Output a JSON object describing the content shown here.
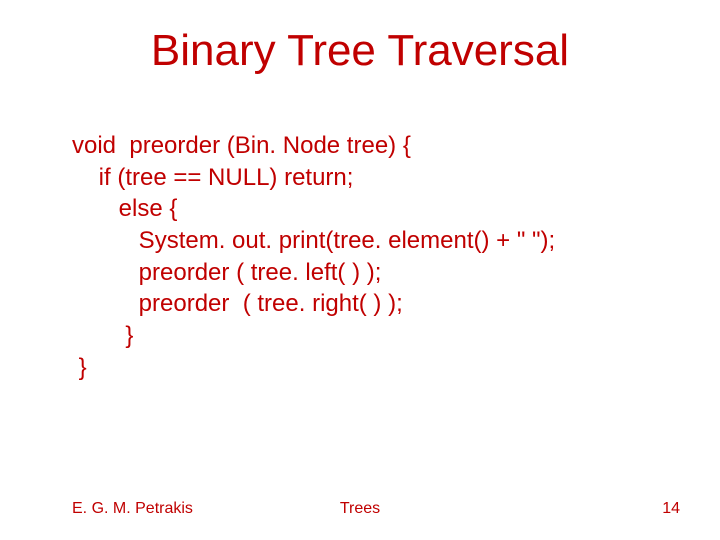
{
  "title": "Binary Tree Traversal",
  "code": {
    "lines": [
      "void  preorder (Bin. Node tree) {",
      "    if (tree == NULL) return;",
      "       else {",
      "          System. out. print(tree. element() + \" \");",
      "          preorder ( tree. left( ) );",
      "          preorder  ( tree. right( ) );",
      "        }",
      " }"
    ]
  },
  "footer": {
    "author": "E. G. M. Petrakis",
    "topic": "Trees",
    "page": "14"
  }
}
